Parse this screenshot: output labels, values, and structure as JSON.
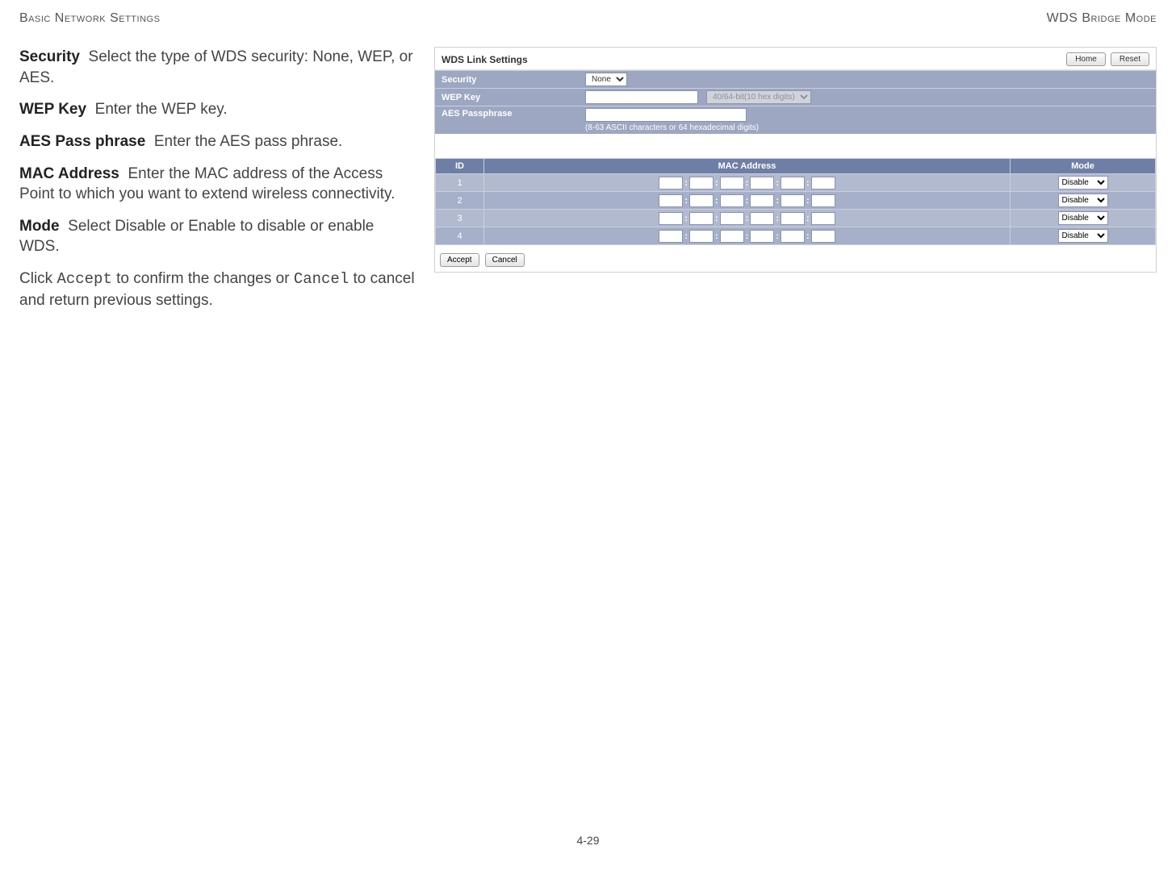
{
  "header": {
    "left": "Basic Network Settings",
    "right": "WDS Bridge Mode"
  },
  "desc": {
    "security_label": "Security",
    "security_text": "Select the type of WDS security: None, WEP, or AES.",
    "wep_label": "WEP Key",
    "wep_text": "Enter the WEP key.",
    "aes_label": "AES Pass phrase",
    "aes_text": "Enter the AES pass phrase.",
    "mac_label": "MAC Address",
    "mac_text": "Enter the MAC address of the Access Point to which you want to extend wireless connectivity.",
    "mode_label": "Mode",
    "mode_text": "Select Disable or Enable to disable or enable WDS.",
    "confirm_pre": "Click ",
    "confirm_accept": "Accept",
    "confirm_mid": " to confirm the changes or ",
    "confirm_cancel": "Cancel",
    "confirm_post": " to cancel and return previous settings."
  },
  "screenshot": {
    "title": "WDS Link Settings",
    "home_btn": "Home",
    "reset_btn": "Reset",
    "rows": {
      "security_label": "Security",
      "security_value": "None",
      "wep_label": "WEP Key",
      "wep_hint": "40/64-bit(10 hex digits)",
      "aes_label": "AES Passphrase",
      "aes_hint": "(8-63 ASCII characters or 64 hexadecimal digits)"
    },
    "table": {
      "col_id": "ID",
      "col_mac": "MAC Address",
      "col_mode": "Mode",
      "rows": [
        {
          "id": "1",
          "mode": "Disable"
        },
        {
          "id": "2",
          "mode": "Disable"
        },
        {
          "id": "3",
          "mode": "Disable"
        },
        {
          "id": "4",
          "mode": "Disable"
        }
      ]
    },
    "accept_btn": "Accept",
    "cancel_btn": "Cancel"
  },
  "page_number": "4-29"
}
